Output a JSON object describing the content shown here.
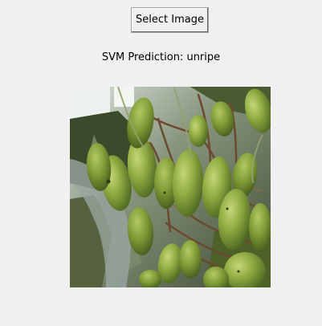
{
  "window": {
    "background": "#f0f0f0"
  },
  "select_button": {
    "label": "Select Image"
  },
  "prediction": {
    "prefix": "SVM Prediction: ",
    "label": "unripe"
  },
  "image": {
    "subject": "green-mango-cluster",
    "colors": {
      "fruit_dark": "#5e7a2a",
      "fruit_mid": "#8aa63c",
      "fruit_light": "#b9cc6a",
      "stem": "#6b4a2f",
      "sky": "#e8efe8"
    }
  }
}
